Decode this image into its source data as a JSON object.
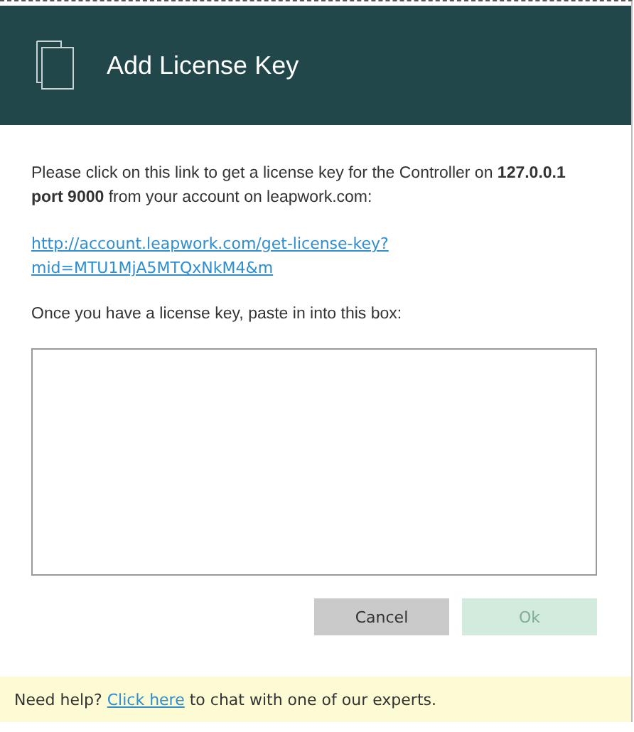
{
  "dialog": {
    "title": "Add License Key"
  },
  "instructions": "Please click on this link to get a license key for the Controller on **127.0.0.1 port 9000** from your account on leapwork.com:",
  "license_link": "http://account.leapwork.com/get-license-key?mid=MTU1MjA5MTQxNkM4&m",
  "paste_label": "Once you have a license key, paste in into this box:",
  "buttons": [
    {
      "label": "Cancel",
      "kind": "secondary",
      "disabled": false
    },
    {
      "label": "Ok",
      "kind": "primary",
      "disabled": true
    }
  ],
  "help_bar": {
    "before": "Need help?",
    "link": "Click here",
    "after": "to chat with one of our experts."
  }
}
